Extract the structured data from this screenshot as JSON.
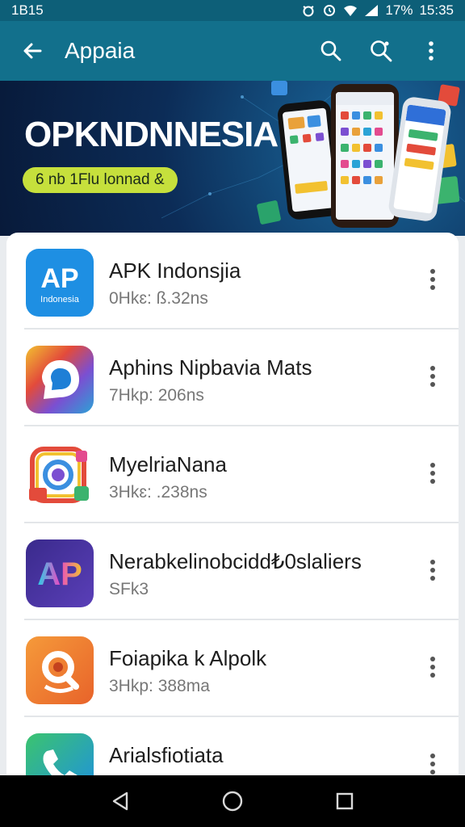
{
  "status_bar": {
    "left_text": "1B15",
    "battery": "17%",
    "time": "15:35",
    "icons": [
      "alarm-icon",
      "clock-icon",
      "wifi-icon",
      "signal-icon",
      "battery-icon"
    ]
  },
  "app_bar": {
    "title": "Appaia",
    "icons": [
      "back-arrow-icon",
      "search-icon",
      "search-alt-icon",
      "overflow-menu-icon"
    ]
  },
  "banner": {
    "title": "OPKNDNNESIA",
    "pill": "6 nb 1Flu lonnad &"
  },
  "apps": [
    {
      "name": "APK Indonsjia",
      "size": "0Hkɛ: ß.32ns",
      "icon_text": "AP",
      "icon_subtext": "Indonesia",
      "icon": "apk-indonesia-icon"
    },
    {
      "name": "Aphins Nipbavia Mats",
      "size": "7Hkp: 206ns",
      "icon_text": "",
      "icon_subtext": "",
      "icon": "chat-bubble-icon"
    },
    {
      "name": "MyelriaNana",
      "size": "3Hkɛ: .238ns",
      "icon_text": "",
      "icon_subtext": "",
      "icon": "camera-collage-icon"
    },
    {
      "name": "Nerabkelinobcidd₺0slaliers",
      "size": "SFk3",
      "icon_text": "AP",
      "icon_subtext": "",
      "icon": "ap-gradient-icon"
    },
    {
      "name": "Foiapika k Alpolk",
      "size": "3Hkp: 388ma",
      "icon_text": "",
      "icon_subtext": "",
      "icon": "orange-search-icon"
    },
    {
      "name": "Arialsfiotiata",
      "size": "",
      "icon_text": "",
      "icon_subtext": "",
      "icon": "phone-call-icon"
    }
  ],
  "nav_bar": {
    "icons": [
      "back-triangle-icon",
      "home-circle-icon",
      "recents-square-icon"
    ]
  },
  "colors": {
    "status_bar": "#0d5f78",
    "app_bar": "#12708c",
    "banner_pill": "#c6e03c",
    "card_bg": "#ffffff"
  }
}
